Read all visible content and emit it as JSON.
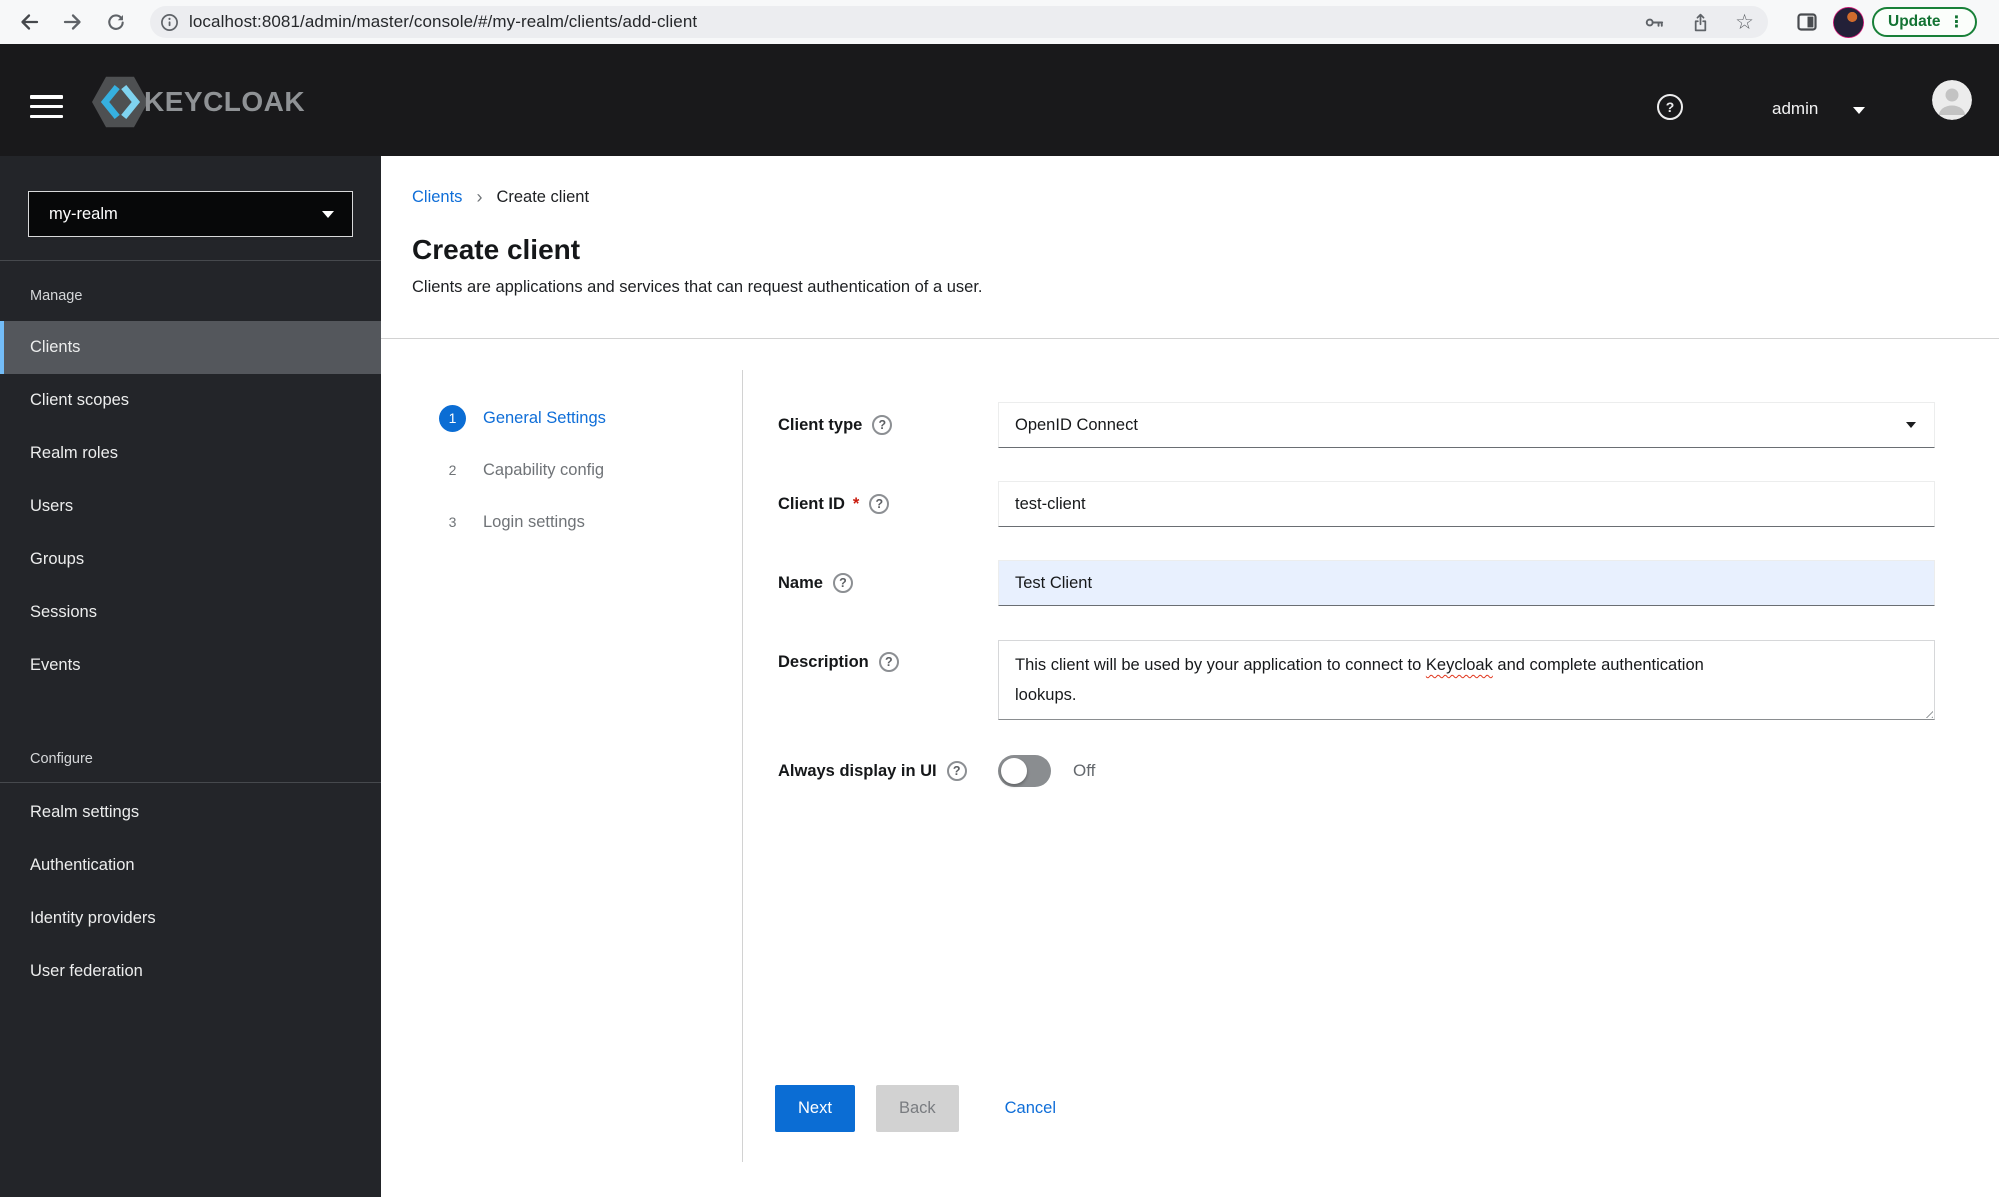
{
  "browser": {
    "url": "localhost:8081/admin/master/console/#/my-realm/clients/add-client",
    "update_label": "Update"
  },
  "masthead": {
    "brand": "KEYCLOAK",
    "user": "admin"
  },
  "sidebar": {
    "realm_selector": "my-realm",
    "selected_item": "Clients",
    "manage": {
      "label": "Manage",
      "items": [
        "Clients",
        "Client scopes",
        "Realm roles",
        "Users",
        "Groups",
        "Sessions",
        "Events"
      ]
    },
    "configure": {
      "label": "Configure",
      "items": [
        "Realm settings",
        "Authentication",
        "Identity providers",
        "User federation"
      ]
    }
  },
  "breadcrumb": {
    "items": [
      "Clients",
      "Create client"
    ]
  },
  "page": {
    "title": "Create client",
    "subtitle": "Clients are applications and services that can request authentication of a user."
  },
  "wizard": {
    "steps": [
      {
        "number": "1",
        "label": "General Settings",
        "active": true
      },
      {
        "number": "2",
        "label": "Capability config",
        "active": false
      },
      {
        "number": "3",
        "label": "Login settings",
        "active": false
      }
    ]
  },
  "form": {
    "fields": {
      "client_type": {
        "label": "Client type",
        "value": "OpenID Connect"
      },
      "client_id": {
        "label": "Client ID",
        "required_marker": "*",
        "value": "test-client"
      },
      "name": {
        "label": "Name",
        "value": "Test Client"
      },
      "description": {
        "label": "Description",
        "text_before_word": "This client will be used by your application to connect to ",
        "misspelled_word": "Keycloak",
        "text_after_word": " and complete authentication",
        "text_line2": "lookups."
      },
      "always_display": {
        "label": "Always display in UI",
        "state_label": "Off"
      }
    },
    "actions": {
      "next": "Next",
      "back": "Back",
      "cancel": "Cancel"
    }
  },
  "icons": {
    "help_glyph": "?",
    "breadcrumb_separator": "›",
    "star_glyph": "☆",
    "kebab_glyph": "⋮"
  },
  "colors": {
    "accent_blue": "#0b6dd4",
    "masthead_bg": "#19191b",
    "sidebar_bg": "#232529",
    "nav_selected_bg": "#54575c",
    "nav_selected_bar": "#73bcf7",
    "autofill_bg": "#e8f0fe",
    "update_green": "#137333",
    "required_red": "#c9190b",
    "divider": "#d2d2d2"
  }
}
